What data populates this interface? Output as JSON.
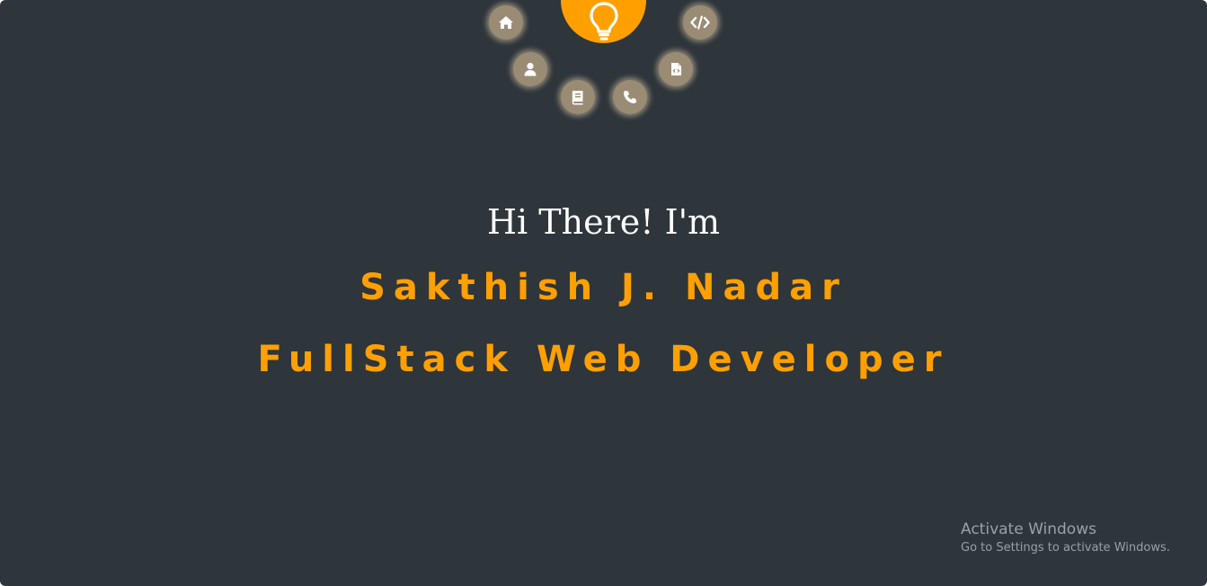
{
  "nav": {
    "hub_icon": "lightbulb-icon",
    "items": [
      {
        "icon": "home-icon"
      },
      {
        "icon": "user-icon"
      },
      {
        "icon": "book-icon"
      },
      {
        "icon": "phone-icon"
      },
      {
        "icon": "file-code-icon"
      },
      {
        "icon": "code-icon"
      }
    ]
  },
  "hero": {
    "greeting": "Hi There! I'm",
    "name": "Sakthish J. Nadar",
    "role": "FullStack Web Developer"
  },
  "watermark": {
    "title": "Activate Windows",
    "subtitle": "Go to Settings to activate Windows."
  },
  "colors": {
    "background": "#2e353b",
    "accent": "#ffa000",
    "nav_button": "#9a8c74",
    "text": "#ffffff"
  }
}
